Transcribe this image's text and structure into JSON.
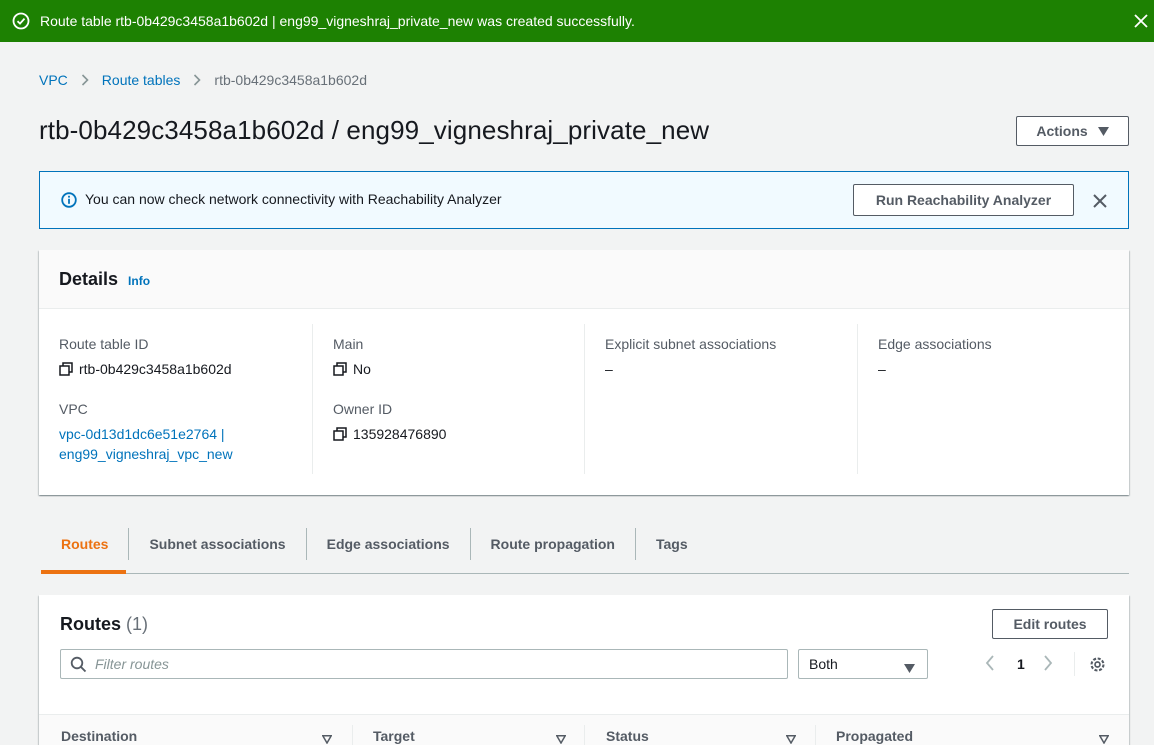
{
  "flash": {
    "message": "Route table rtb-0b429c3458a1b602d | eng99_vigneshraj_private_new was created successfully.",
    "color": "#1d8102",
    "icon": "check-circle-icon",
    "close_icon": "close-icon"
  },
  "breadcrumb": {
    "items": [
      "VPC",
      "Route tables",
      "rtb-0b429c3458a1b602d"
    ]
  },
  "page": {
    "title": "rtb-0b429c3458a1b602d / eng99_vigneshraj_private_new",
    "actions_label": "Actions"
  },
  "info_alert": {
    "message": "You can now check network connectivity with Reachability Analyzer",
    "button_label": "Run Reachability Analyzer",
    "icon": "info-circle-icon"
  },
  "details": {
    "heading": "Details",
    "info_link": "Info",
    "route_table_id_label": "Route table ID",
    "route_table_id": "rtb-0b429c3458a1b602d",
    "vpc_label": "VPC",
    "vpc_line1": "vpc-0d13d1dc6e51e2764 |",
    "vpc_line2": "eng99_vigneshraj_vpc_new",
    "main_label": "Main",
    "main_value": "No",
    "owner_id_label": "Owner ID",
    "owner_id": "135928476890",
    "explicit_subnet_label": "Explicit subnet associations",
    "explicit_subnet_value": "–",
    "edge_assoc_label": "Edge associations",
    "edge_assoc_value": "–"
  },
  "tabs": [
    {
      "label": "Routes",
      "active": true
    },
    {
      "label": "Subnet associations",
      "active": false
    },
    {
      "label": "Edge associations",
      "active": false
    },
    {
      "label": "Route propagation",
      "active": false
    },
    {
      "label": "Tags",
      "active": false
    }
  ],
  "routes": {
    "heading": "Routes",
    "count": "(1)",
    "edit_label": "Edit routes",
    "filter_placeholder": "Filter routes",
    "select_value": "Both",
    "page_number": "1",
    "columns": [
      "Destination",
      "Target",
      "Status",
      "Propagated"
    ]
  },
  "colors": {
    "accent": "#ec7211",
    "link": "#0073bb",
    "success": "#1d8102"
  }
}
